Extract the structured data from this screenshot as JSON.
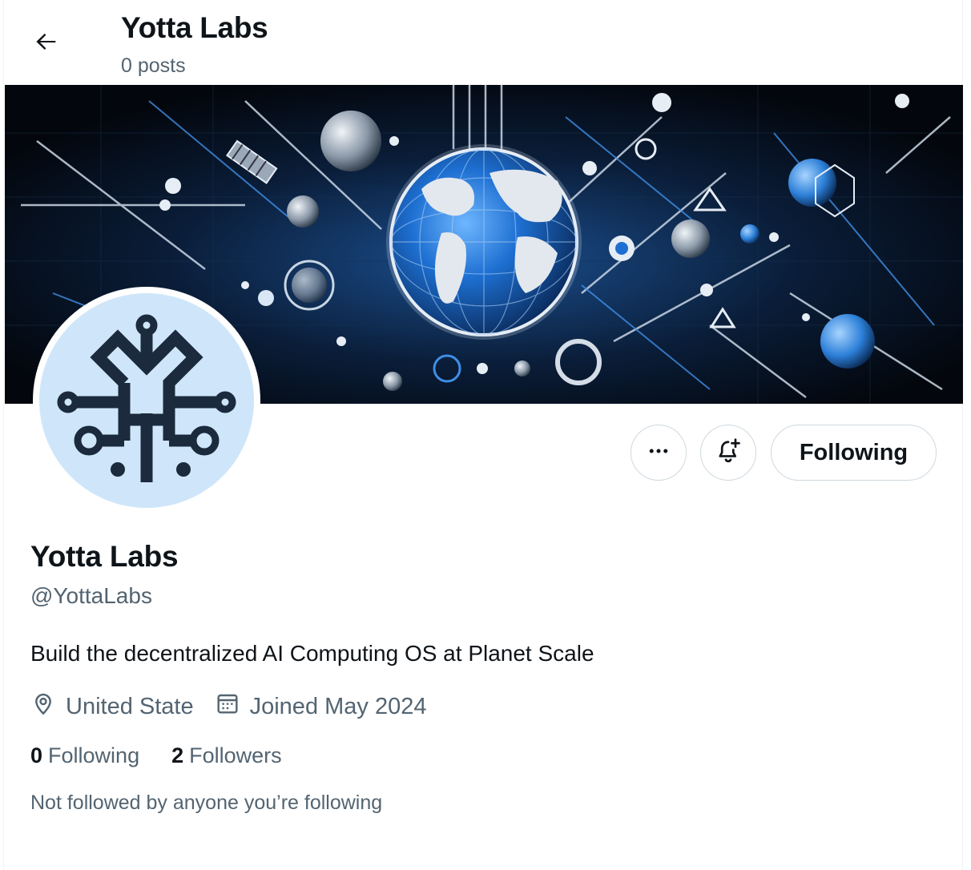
{
  "header": {
    "title": "Yotta Labs",
    "posts_count": "0 posts"
  },
  "profile": {
    "display_name": "Yotta Labs",
    "handle": "@YottaLabs",
    "bio": "Build the decentralized AI Computing OS at Planet Scale",
    "location": "United State",
    "joined": "Joined May 2024",
    "following_count": "0",
    "following_label": "Following",
    "followers_count": "2",
    "followers_label": "Followers",
    "followed_by_note": "Not followed by anyone you’re following"
  },
  "actions": {
    "more_icon": "more-horizontal-icon",
    "notify_icon": "bell-plus-icon",
    "follow_state_label": "Following"
  },
  "icons": {
    "back": "arrow-left-icon",
    "location": "location-pin-icon",
    "calendar": "calendar-icon"
  },
  "colors": {
    "text_primary": "#0f1419",
    "text_secondary": "#536471",
    "border": "#cfd9de",
    "avatar_bg": "#cfe6fa",
    "logo_color": "#1b2a3d",
    "banner_blue": "#1d6fd1"
  }
}
